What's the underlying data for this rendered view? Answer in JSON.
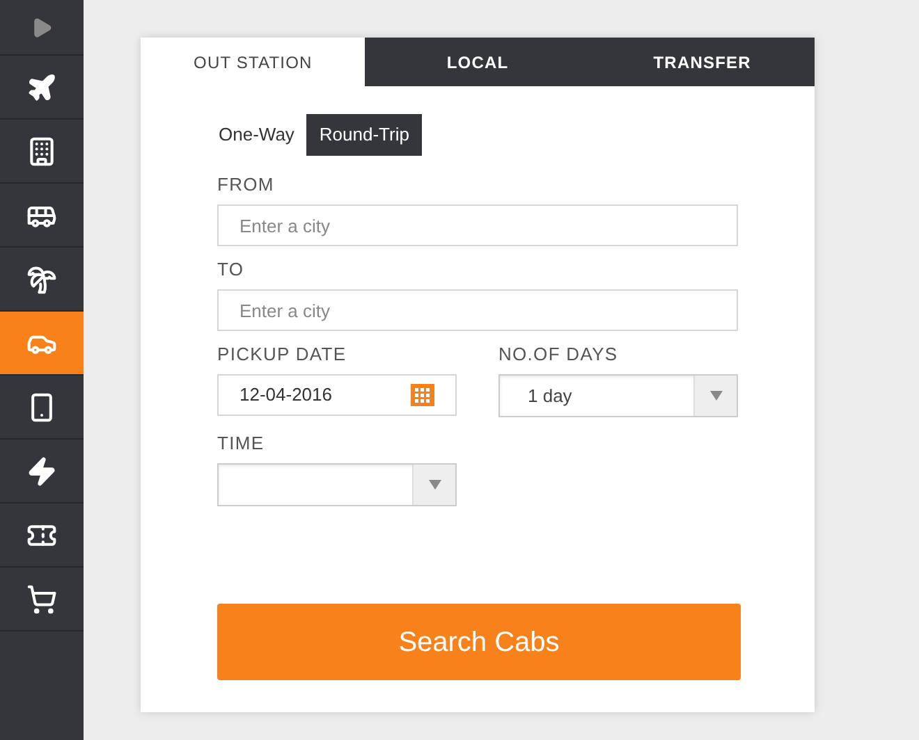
{
  "sidebar": {
    "items": [
      {
        "selected": false
      },
      {
        "selected": false
      },
      {
        "selected": false
      },
      {
        "selected": false
      },
      {
        "selected": false
      },
      {
        "selected": true
      },
      {
        "selected": false
      },
      {
        "selected": false
      },
      {
        "selected": false
      },
      {
        "selected": false
      }
    ]
  },
  "tabs": [
    {
      "label": "OUT STATION",
      "selected": true
    },
    {
      "label": "LOCAL",
      "selected": false
    },
    {
      "label": "TRANSFER",
      "selected": false
    }
  ],
  "trip_types": [
    {
      "label": "One-Way",
      "selected": false
    },
    {
      "label": "Round-Trip",
      "selected": true
    }
  ],
  "from": {
    "label": "FROM",
    "placeholder": "Enter a city"
  },
  "to": {
    "label": "TO",
    "placeholder": "Enter a city"
  },
  "pickup_date": {
    "label": "PICKUP DATE",
    "value": "12-04-2016"
  },
  "days": {
    "label": "NO.OF DAYS",
    "value": "1 day"
  },
  "time": {
    "label": "TIME"
  },
  "search_button": "Search Cabs"
}
